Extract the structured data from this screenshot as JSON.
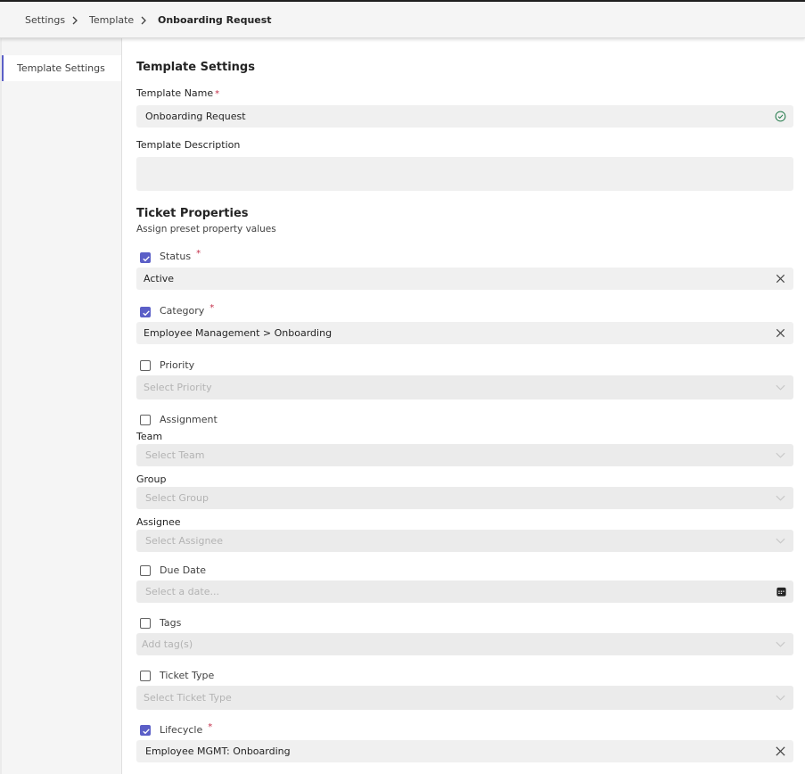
{
  "breadcrumb": {
    "items": [
      "Settings",
      "Template"
    ],
    "current": "Onboarding Request"
  },
  "sidebar": {
    "items": [
      {
        "label": "Template Settings"
      }
    ]
  },
  "template_settings": {
    "title": "Template Settings",
    "name_label": "Template Name",
    "name_value": "Onboarding Request",
    "description_label": "Template Description",
    "description_value": ""
  },
  "ticket_properties": {
    "title": "Ticket Properties",
    "subtitle": "Assign preset property values",
    "required_mark": "*",
    "status": {
      "label": "Status",
      "checked": true,
      "value": "Active"
    },
    "category": {
      "label": "Category",
      "checked": true,
      "value": "Employee Management > Onboarding"
    },
    "priority": {
      "label": "Priority",
      "checked": false,
      "placeholder": "Select Priority"
    },
    "assignment": {
      "label": "Assignment",
      "checked": false,
      "team_label": "Team",
      "team_placeholder": "Select Team",
      "group_label": "Group",
      "group_placeholder": "Select Group",
      "assignee_label": "Assignee",
      "assignee_placeholder": "Select Assignee"
    },
    "due_date": {
      "label": "Due Date",
      "checked": false,
      "placeholder": "Select a date..."
    },
    "tags": {
      "label": "Tags",
      "checked": false,
      "placeholder": "Add tag(s)"
    },
    "ticket_type": {
      "label": "Ticket Type",
      "checked": false,
      "placeholder": "Select Ticket Type"
    },
    "lifecycle": {
      "label": "Lifecycle",
      "checked": true,
      "value": "Employee MGMT: Onboarding"
    }
  },
  "colors": {
    "accent": "#5b5fc7",
    "required": "#c4314b",
    "success": "#237b4b"
  },
  "icons": {
    "breadcrumb_separator": "chevron-right-icon",
    "valid": "check-circle-icon",
    "clear": "close-icon",
    "dropdown": "chevron-down-icon",
    "calendar": "calendar-icon"
  }
}
